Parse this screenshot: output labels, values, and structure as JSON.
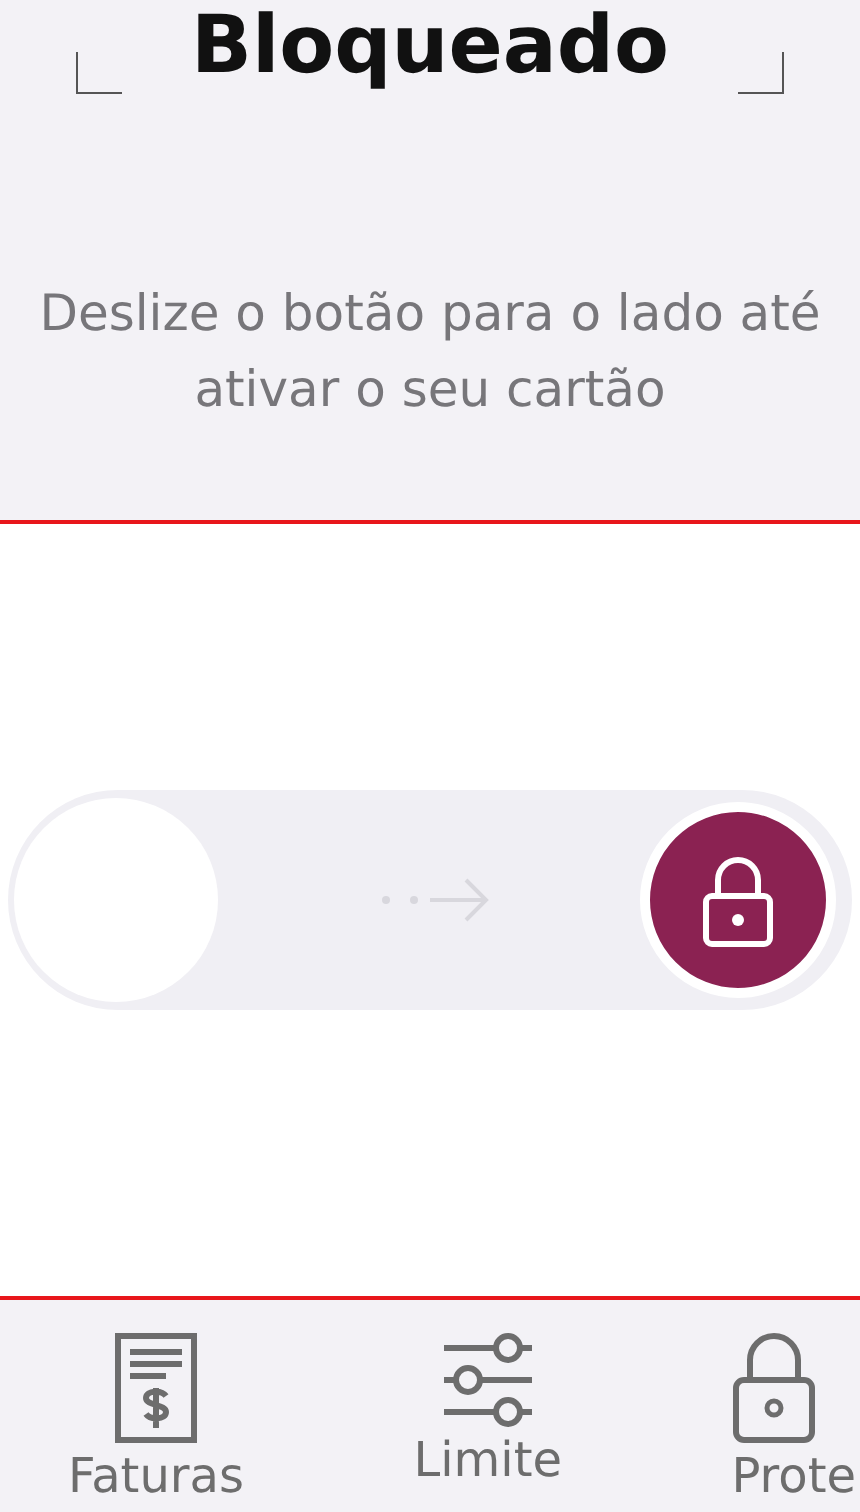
{
  "header": {
    "title": "Bloqueado",
    "instruction": "Deslize o botão para o lado até ativar o seu cartão"
  },
  "slider": {
    "level": 0
  },
  "nav": [
    {
      "label": "Faturas",
      "kind": "bill"
    },
    {
      "label": "Limite",
      "kind": "sliders"
    },
    {
      "label": "Prote",
      "kind": "lock"
    }
  ]
}
